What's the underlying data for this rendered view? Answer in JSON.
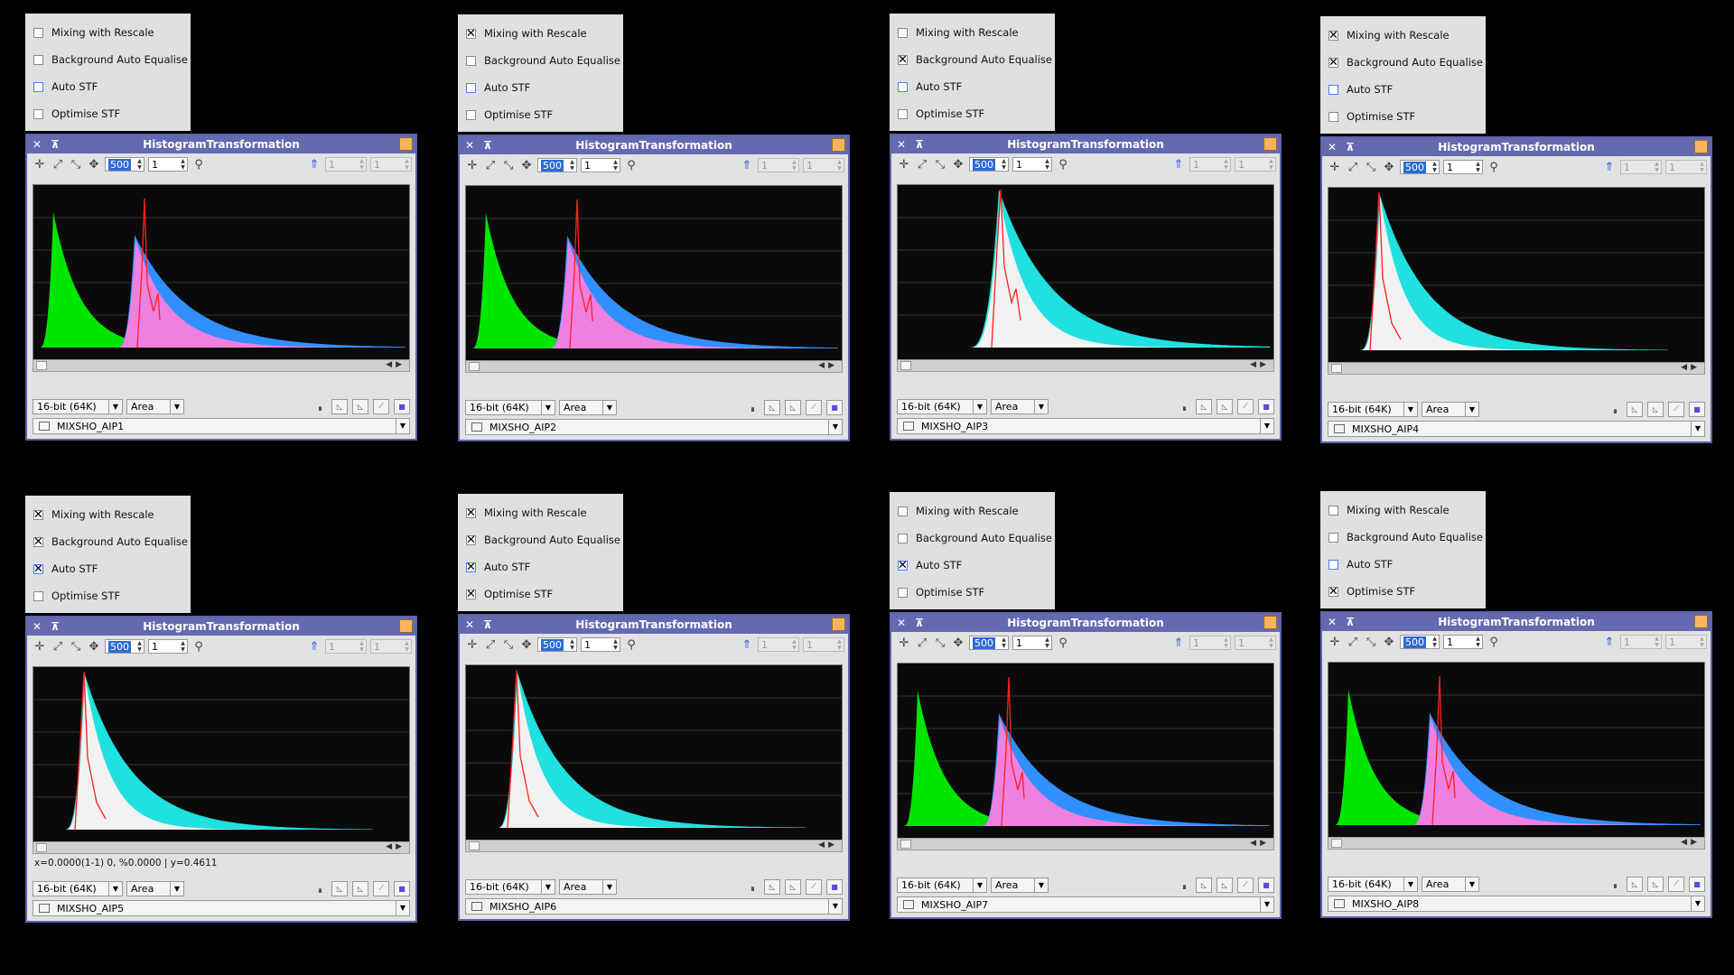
{
  "option_labels": [
    "Mixing with Rescale",
    "Background Auto Equalise",
    "Auto STF",
    "Optimise STF"
  ],
  "window_title": "HistogramTransformation",
  "toolbar": {
    "zoom_x": "500",
    "zoom_y": "1",
    "readout_a": "1",
    "readout_b": "1"
  },
  "bit_depth": "16-bit (64K)",
  "graph_style": "Area",
  "icons": {
    "close": "close-icon",
    "shade": "shade-icon",
    "pan": "pan-icon",
    "zoom": "zoom-icon",
    "up": "arrow-up-icon"
  },
  "panels": [
    {
      "view": "MIXSHO_AIP1",
      "checks": [
        false,
        false,
        false,
        false
      ],
      "shape": "split",
      "status": ""
    },
    {
      "view": "MIXSHO_AIP2",
      "checks": [
        true,
        false,
        false,
        false
      ],
      "shape": "split",
      "status": ""
    },
    {
      "view": "MIXSHO_AIP3",
      "checks": [
        false,
        true,
        false,
        false
      ],
      "shape": "merged",
      "status": ""
    },
    {
      "view": "MIXSHO_AIP4",
      "checks": [
        true,
        true,
        false,
        false
      ],
      "shape": "merged_left",
      "status": ""
    },
    {
      "view": "MIXSHO_AIP5",
      "checks": [
        true,
        true,
        true,
        false
      ],
      "shape": "merged_left",
      "status": "x=0.0000(1-1) 0, %0.0000 | y=0.4611"
    },
    {
      "view": "MIXSHO_AIP6",
      "checks": [
        true,
        true,
        true,
        true
      ],
      "shape": "merged_left",
      "status": ""
    },
    {
      "view": "MIXSHO_AIP7",
      "checks": [
        false,
        false,
        true,
        false
      ],
      "shape": "split",
      "status": ""
    },
    {
      "view": "MIXSHO_AIP8",
      "checks": [
        false,
        false,
        false,
        true
      ],
      "shape": "split",
      "status": ""
    }
  ],
  "colors": {
    "green": "#00e600",
    "pink": "#f080e0",
    "red": "#ff2020",
    "blue": "#3090ff",
    "white": "#f2f2f2",
    "cyan": "#20e0e0"
  }
}
